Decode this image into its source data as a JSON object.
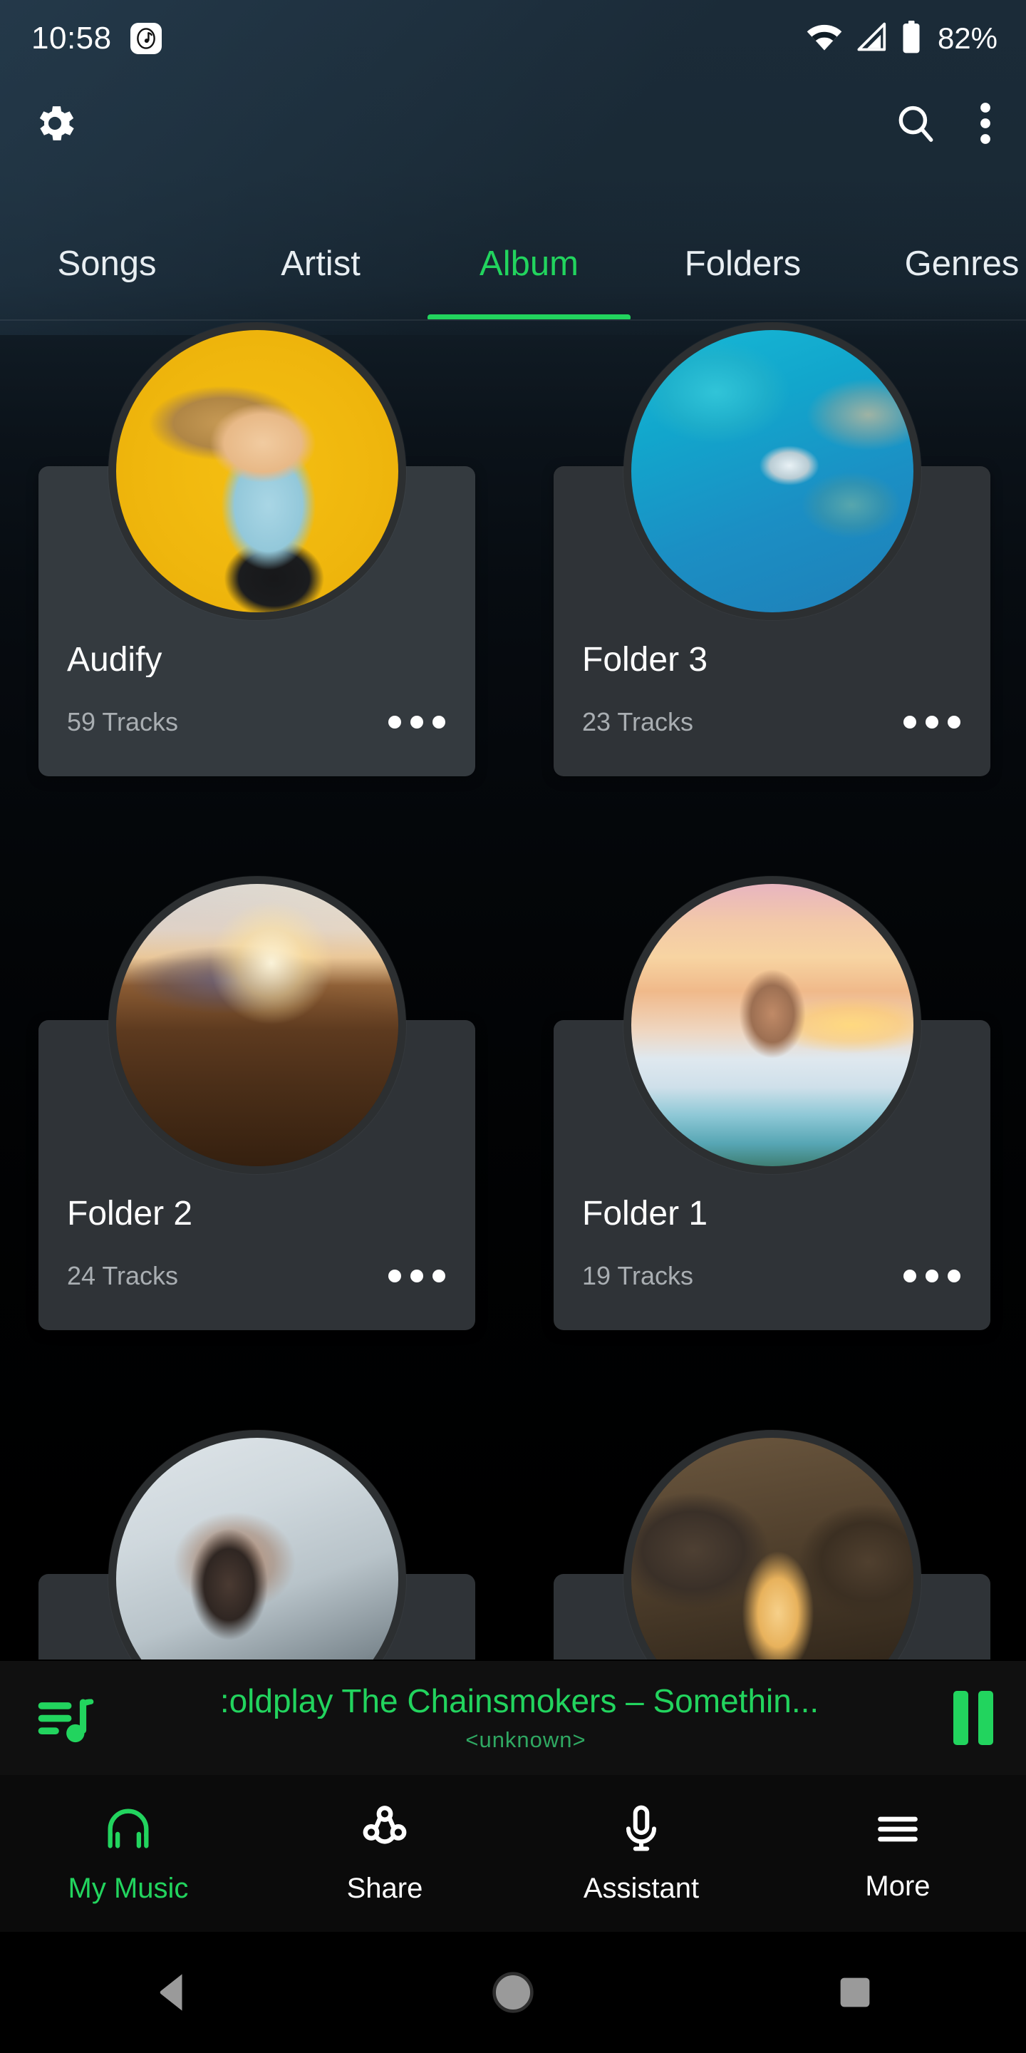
{
  "status_bar": {
    "time": "10:58",
    "notification_icon": "music-note-notification-icon",
    "wifi_icon": "wifi-icon",
    "signal_icon": "cellular-signal-icon",
    "battery_icon": "battery-icon",
    "battery_text": "82%"
  },
  "app_bar": {
    "settings_icon": "gear-icon",
    "search_icon": "search-icon",
    "overflow_icon": "more-vertical-icon"
  },
  "tabs": {
    "active_color": "#22d45e",
    "items": [
      {
        "label": "Songs",
        "active": false
      },
      {
        "label": "Artist",
        "active": false
      },
      {
        "label": "Album",
        "active": true
      },
      {
        "label": "Folders",
        "active": false
      },
      {
        "label": "Genres",
        "active": false
      }
    ]
  },
  "albums": [
    {
      "title": "Audify",
      "tracks": "59 Tracks",
      "art": "img-audify",
      "menu_icon": "overflow-dots-icon"
    },
    {
      "title": "Folder 3",
      "tracks": "23 Tracks",
      "art": "img-folder3",
      "menu_icon": "overflow-dots-icon"
    },
    {
      "title": "Folder 2",
      "tracks": "24 Tracks",
      "art": "img-folder2",
      "menu_icon": "overflow-dots-icon"
    },
    {
      "title": "Folder 1",
      "tracks": "19 Tracks",
      "art": "img-folder1",
      "menu_icon": "overflow-dots-icon"
    },
    {
      "title": "",
      "tracks": "",
      "art": "img-row3a",
      "menu_icon": "overflow-dots-icon"
    },
    {
      "title": "",
      "tracks": "",
      "art": "img-row3b",
      "menu_icon": "overflow-dots-icon"
    }
  ],
  "now_playing": {
    "queue_icon": "playlist-music-icon",
    "title": ":oldplay The Chainsmokers – Somethin...",
    "subtitle": "<unknown>",
    "pause_icon": "pause-icon",
    "accent_color": "#22d45e"
  },
  "bottom_nav": {
    "items": [
      {
        "label": "My Music",
        "icon": "headphones-icon",
        "active": true
      },
      {
        "label": "Share",
        "icon": "share-icon",
        "active": false
      },
      {
        "label": "Assistant",
        "icon": "microphone-icon",
        "active": false
      },
      {
        "label": "More",
        "icon": "hamburger-menu-icon",
        "active": false
      }
    ]
  },
  "android_nav": {
    "back_icon": "back-triangle-icon",
    "home_icon": "home-circle-icon",
    "recents_icon": "recents-square-icon"
  }
}
